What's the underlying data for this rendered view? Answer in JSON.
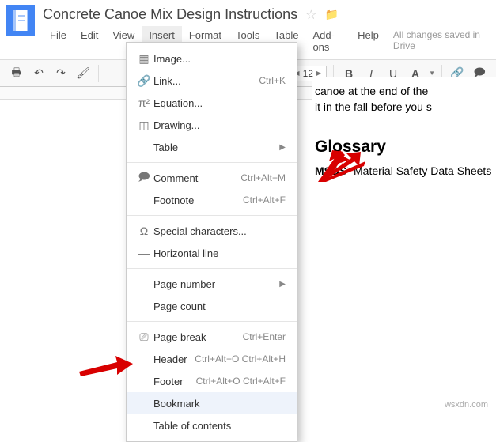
{
  "doc": {
    "title": "Concrete Canoe Mix Design Instructions"
  },
  "menubar": {
    "file": "File",
    "edit": "Edit",
    "view": "View",
    "insert": "Insert",
    "format": "Format",
    "tools": "Tools",
    "table": "Table",
    "addons": "Add-ons",
    "help": "Help",
    "save_status": "All changes saved in Drive"
  },
  "toolbar": {
    "font_size": "12"
  },
  "insert_menu": {
    "image": "Image...",
    "link": "Link...",
    "link_short": "Ctrl+K",
    "equation": "Equation...",
    "drawing": "Drawing...",
    "table": "Table",
    "comment": "Comment",
    "comment_short": "Ctrl+Alt+M",
    "footnote": "Footnote",
    "footnote_short": "Ctrl+Alt+F",
    "special": "Special characters...",
    "hr": "Horizontal line",
    "page_num": "Page number",
    "page_count": "Page count",
    "page_break": "Page break",
    "page_break_short": "Ctrl+Enter",
    "header": "Header",
    "header_short": "Ctrl+Alt+O Ctrl+Alt+H",
    "footer": "Footer",
    "footer_short": "Ctrl+Alt+O Ctrl+Alt+F",
    "bookmark": "Bookmark",
    "toc": "Table of contents"
  },
  "document": {
    "line1": "canoe at the end of the",
    "line2": "it in the fall before you s",
    "glossary_heading": "Glossary",
    "glossary_term": "MSDS",
    "glossary_def": "- Material Safety Data Sheets"
  },
  "watermark": "wsxdn.com"
}
